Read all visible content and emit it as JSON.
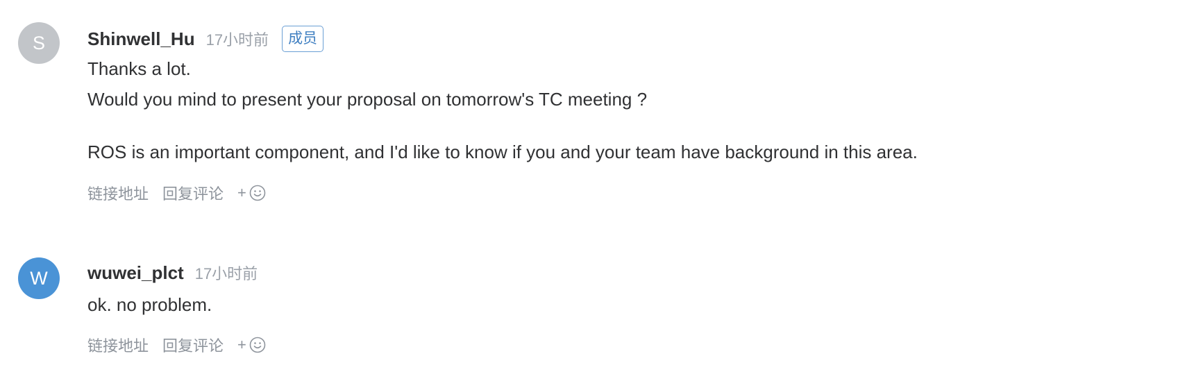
{
  "colors": {
    "avatar_s": "#c2c5c9",
    "avatar_w": "#4a93d6",
    "badge": "#3f7fc1",
    "muted": "#8e949c"
  },
  "comments": [
    {
      "avatar_letter": "S",
      "author": "Shinwell_Hu",
      "time": "17小时前",
      "badge": "成员",
      "lines": [
        "Thanks a lot.",
        "Would you mind to present your proposal on tomorrow's TC meeting ?",
        "ROS is an important component, and I'd like to know if you and your team have background in this area."
      ],
      "actions": {
        "link": "链接地址",
        "reply": "回复评论",
        "plus": "+",
        "emoji_icon": "smiley-icon"
      }
    },
    {
      "avatar_letter": "W",
      "author": "wuwei_plct",
      "time": "17小时前",
      "lines": [
        "ok. no problem."
      ],
      "actions": {
        "link": "链接地址",
        "reply": "回复评论",
        "plus": "+",
        "emoji_icon": "smiley-icon"
      }
    }
  ]
}
